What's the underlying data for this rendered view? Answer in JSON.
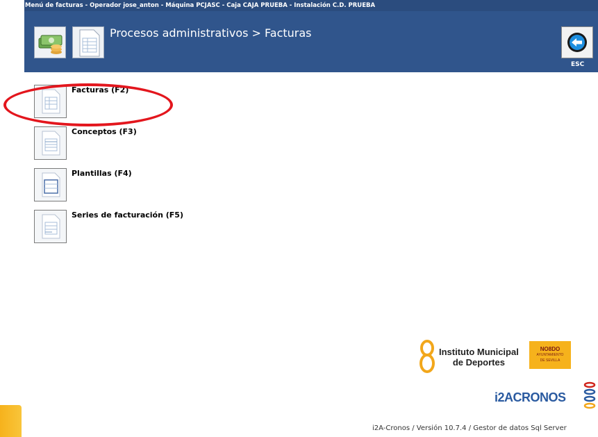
{
  "window": {
    "title": "Menú de facturas - Operador jose_anton - Máquina PCJASC - Caja CAJA PRUEBA - Instalación C.D. PRUEBA"
  },
  "header": {
    "title": "Procesos administrativos > Facturas",
    "esc_label": "ESC"
  },
  "menu": {
    "items": [
      {
        "label": "Facturas (F2)",
        "icon": "invoice-document-icon"
      },
      {
        "label": "Conceptos (F3)",
        "icon": "concepts-document-icon"
      },
      {
        "label": "Plantillas (F4)",
        "icon": "template-document-icon"
      },
      {
        "label": "Series de facturación (F5)",
        "icon": "series-document-icon"
      }
    ]
  },
  "logos": {
    "imd_line1": "Instituto Municipal",
    "imd_line2": "de Deportes",
    "sevilla_line1": "NO8DO",
    "sevilla_line2": "AYUNTAMIENTO",
    "sevilla_line3": "DE SEVILLA",
    "cronos": "i2ACRONOS"
  },
  "footer": {
    "version": "i2A-Cronos / Versión 10.7.4 / Gestor de datos Sql Server"
  },
  "colors": {
    "header_bg": "#30558c",
    "titlebar_bg": "#2b4c7e",
    "highlight": "#e3161d",
    "accent_orange": "#f6b21c"
  }
}
